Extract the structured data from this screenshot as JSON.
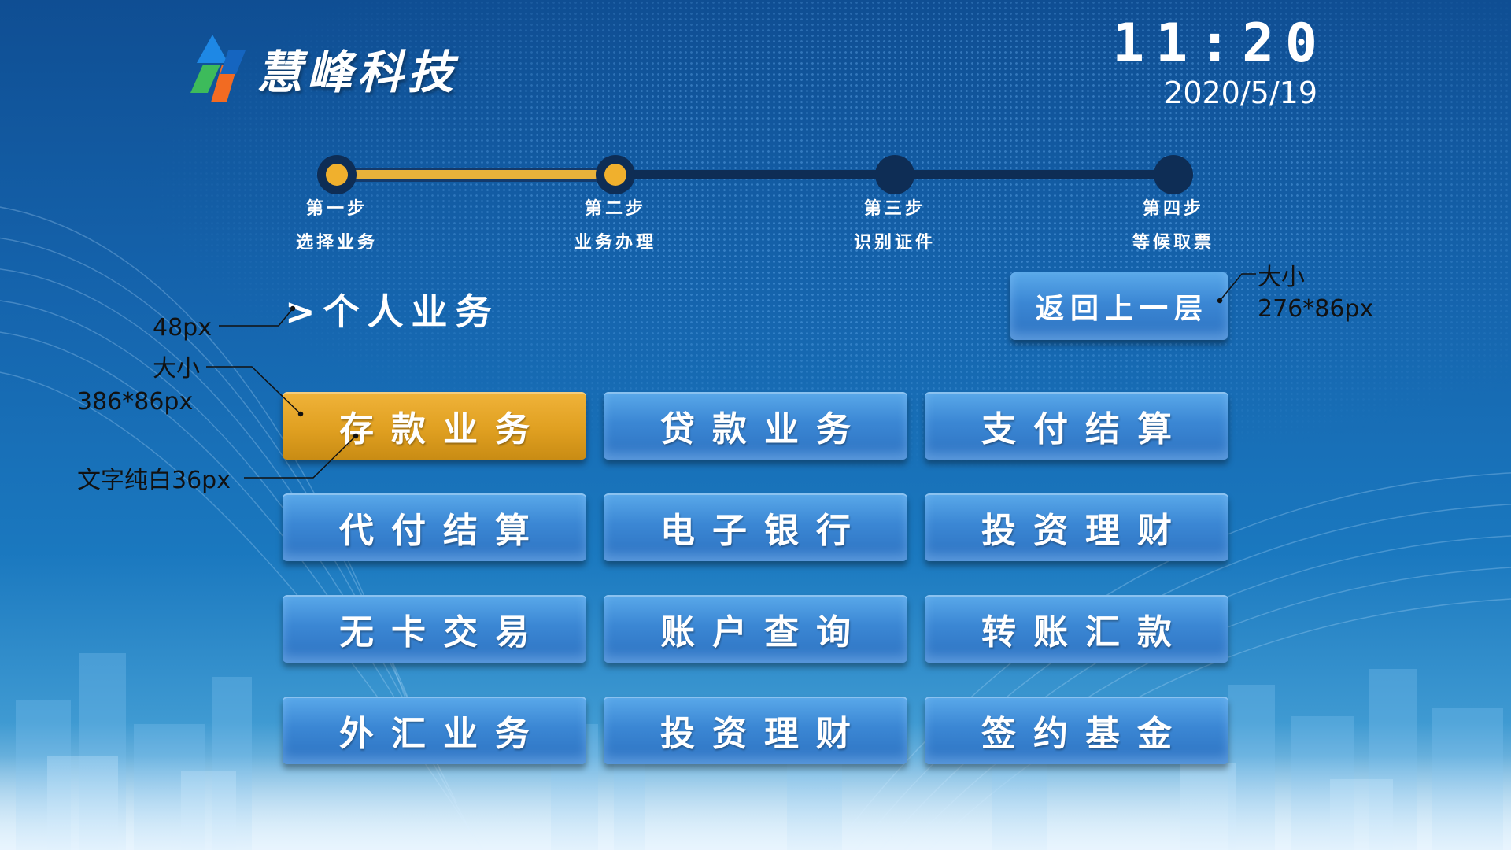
{
  "header": {
    "brand_name": "慧峰科技",
    "time": "11:20",
    "date": "2020/5/19"
  },
  "steps": [
    {
      "step": "第一步",
      "label": "选择业务",
      "status": "done"
    },
    {
      "step": "第二步",
      "label": "业务办理",
      "status": "done"
    },
    {
      "step": "第三步",
      "label": "识别证件",
      "status": "todo"
    },
    {
      "step": "第四步",
      "label": "等候取票",
      "status": "todo"
    }
  ],
  "section": {
    "title": ">个人业务"
  },
  "back_button": {
    "label": "返回上一层"
  },
  "services": [
    {
      "label": "存款业务",
      "active": true
    },
    {
      "label": "贷款业务",
      "active": false
    },
    {
      "label": "支付结算",
      "active": false
    },
    {
      "label": "代付结算",
      "active": false
    },
    {
      "label": "电子银行",
      "active": false
    },
    {
      "label": "投资理财",
      "active": false
    },
    {
      "label": "无卡交易",
      "active": false
    },
    {
      "label": "账户查询",
      "active": false
    },
    {
      "label": "转账汇款",
      "active": false
    },
    {
      "label": "外汇业务",
      "active": false
    },
    {
      "label": "投资理财",
      "active": false
    },
    {
      "label": "签约基金",
      "active": false
    }
  ],
  "annotations": {
    "title_size": "48px",
    "button_size_label": "大小",
    "button_size": "386*86px",
    "button_text": "文字纯白36px",
    "back_size_label": "大小",
    "back_size": "276*86px"
  },
  "colors": {
    "accent_gold": "#f0b02d",
    "button_blue": "#3b87d4",
    "track_dark": "#0e2d55"
  }
}
